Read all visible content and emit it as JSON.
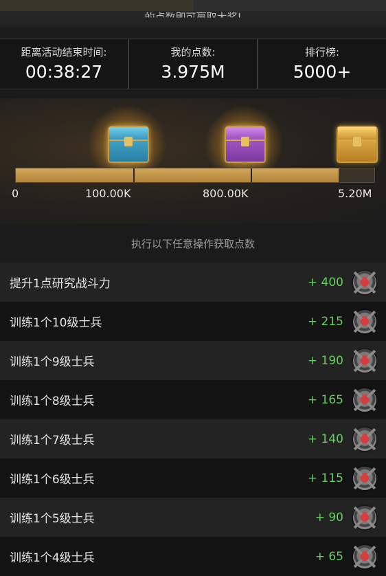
{
  "banner": {
    "text": "的点数即可赢取大奖!"
  },
  "stats": [
    {
      "label": "距离活动结束时间:",
      "value": "00:38:27"
    },
    {
      "label": "我的点数:",
      "value": "3.975M"
    },
    {
      "label": "排行榜:",
      "value": "5000+"
    }
  ],
  "progress": {
    "milestones": [
      "0",
      "100.00K",
      "800.00K",
      "5.20M"
    ],
    "fill_fraction": 0.9,
    "chests": [
      {
        "name": "blue-chest",
        "color": "#4fb6d8"
      },
      {
        "name": "purple-chest",
        "color": "#b765d6"
      },
      {
        "name": "gold-chest",
        "color": "#f0be55"
      }
    ]
  },
  "tasks_title": "执行以下任意操作获取点数",
  "tasks": [
    {
      "label": "提升1点研究战斗力",
      "points": "+ 400",
      "icon": "war-badge-icon"
    },
    {
      "label": "训练1个10级士兵",
      "points": "+ 215",
      "icon": "war-badge-icon"
    },
    {
      "label": "训练1个9级士兵",
      "points": "+ 190",
      "icon": "war-badge-icon"
    },
    {
      "label": "训练1个8级士兵",
      "points": "+ 165",
      "icon": "war-badge-icon"
    },
    {
      "label": "训练1个7级士兵",
      "points": "+ 140",
      "icon": "war-badge-icon"
    },
    {
      "label": "训练1个6级士兵",
      "points": "+ 115",
      "icon": "war-badge-icon"
    },
    {
      "label": "训练1个5级士兵",
      "points": "+ 90",
      "icon": "war-badge-icon"
    },
    {
      "label": "训练1个4级士兵",
      "points": "+ 65",
      "icon": "war-badge-icon"
    }
  ],
  "colors": {
    "points_green": "#5fd35a",
    "bar_gold": "#d2a75a"
  }
}
